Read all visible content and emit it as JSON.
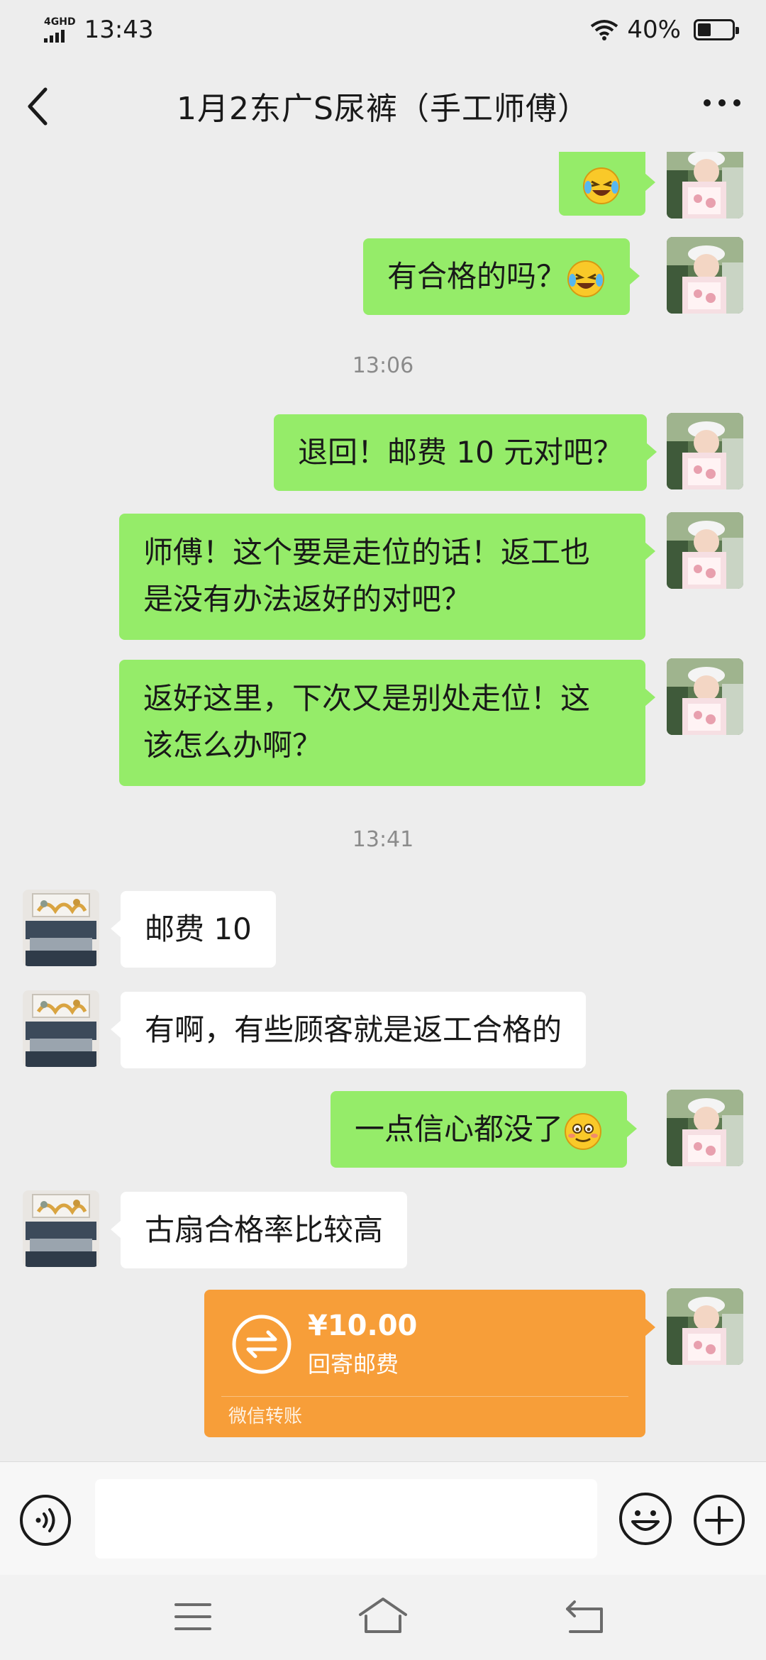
{
  "status": {
    "network": "4GHD",
    "time": "13:43",
    "battery": "40%",
    "battery_level": 0.4
  },
  "header": {
    "title": "1月2东广S尿裤（手工师傅）"
  },
  "messages": {
    "m1": {
      "text": "有合格的吗？"
    },
    "ts1": "13:06",
    "m2": {
      "text": "退回！邮费 10 元对吧？"
    },
    "m3": {
      "line1": "师傅！这个要是走位的话！返工也",
      "line2": "是没有办法返好的对吧？"
    },
    "m4": {
      "line1": "返好这里，下次又是别处走位！这",
      "line2": "该怎么办啊？"
    },
    "ts2": "13:41",
    "m5": {
      "text": "邮费 10"
    },
    "m6": {
      "text": "有啊，有些顾客就是返工合格的"
    },
    "m7": {
      "text": "一点信心都没了"
    },
    "m8": {
      "text": "古扇合格率比较高"
    }
  },
  "transfer": {
    "amount": "¥10.00",
    "note": "回寄邮费",
    "label": "微信转账"
  },
  "icons": {
    "laugh_cry": "laughing-crying-emoji-icon",
    "awkward": "awkward-smile-emoji-icon"
  },
  "colors": {
    "outgoing_bubble": "#95ec69",
    "incoming_bubble": "#ffffff",
    "transfer": "#f79e39",
    "background": "#ededed"
  }
}
